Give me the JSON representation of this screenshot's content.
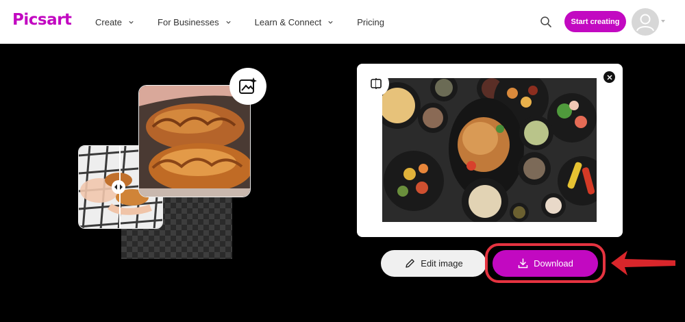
{
  "header": {
    "logo": "Picsart",
    "nav": [
      {
        "label": "Create",
        "has_dropdown": true
      },
      {
        "label": "For Businesses",
        "has_dropdown": true
      },
      {
        "label": "Learn & Connect",
        "has_dropdown": true
      },
      {
        "label": "Pricing",
        "has_dropdown": false
      }
    ],
    "search_icon": "search-icon",
    "cta_label": "Start creating",
    "avatar_icon": "user-avatar-icon"
  },
  "illustration": {
    "badge_icon": "ai-image-icon",
    "handle_icon": "compare-handle-icon"
  },
  "result": {
    "compare_icon": "split-compare-icon",
    "close_icon": "close-icon"
  },
  "actions": {
    "edit_label": "Edit image",
    "download_label": "Download"
  },
  "colors": {
    "brand": "#c209c1",
    "highlight": "#e53340",
    "background": "#000000"
  }
}
